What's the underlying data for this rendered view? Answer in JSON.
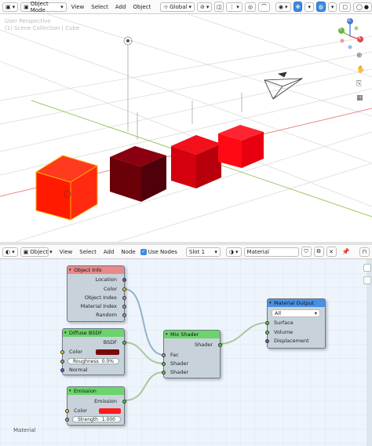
{
  "top_header": {
    "editor_type_icon": "cube-icon",
    "mode_label": "Object Mode",
    "menus": [
      "View",
      "Select",
      "Add",
      "Object"
    ],
    "transform_orientation": "Global"
  },
  "viewport": {
    "perspective_label": "User Perspective",
    "collection_label": "(1) Scene Collection | Cube",
    "gizmo_axes": {
      "z": "Z",
      "y": "Y",
      "x": "X"
    },
    "colors": {
      "cube_red": "#ff1a00",
      "cube_dark": "#7a0008",
      "cube_mid": "#e10010",
      "cube_bright": "#ff0a10",
      "x_axis": "#e05858",
      "y_axis": "#7ab33a"
    }
  },
  "node_header": {
    "editor_type_icon": "node-editor-icon",
    "object_type": "Object",
    "menus": [
      "View",
      "Select",
      "Add",
      "Node"
    ],
    "use_nodes_label": "Use Nodes",
    "use_nodes_checked": true,
    "slot": "Slot 1",
    "material_name": "Material"
  },
  "nodes": {
    "object_info": {
      "title": "Object Info",
      "outputs": [
        "Location",
        "Color",
        "Object Index",
        "Material Index",
        "Random"
      ],
      "color": "#e88a8a"
    },
    "diffuse": {
      "title": "Diffuse BSDF",
      "output": "BSDF",
      "color_label": "Color",
      "color_value": "#7a0a0a",
      "roughness_label": "Roughness",
      "roughness_value": "0.0%",
      "normal_label": "Normal",
      "header_color": "#6cd46c"
    },
    "emission": {
      "title": "Emission",
      "output": "Emission",
      "color_label": "Color",
      "color_value": "#ff1a1a",
      "strength_label": "Strength",
      "strength_value": "1.000",
      "header_color": "#6cd46c"
    },
    "mix": {
      "title": "Mix Shader",
      "output": "Shader",
      "inputs": [
        "Fac",
        "Shader",
        "Shader"
      ],
      "header_color": "#6cd46c"
    },
    "output": {
      "title": "Material Output",
      "target": "All",
      "inputs": [
        "Surface",
        "Volume",
        "Displacement"
      ],
      "header_color": "#4a90e2"
    }
  },
  "node_editor_label": "Material"
}
